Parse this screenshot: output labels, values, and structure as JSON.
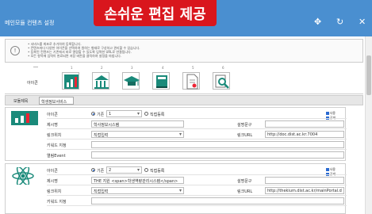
{
  "window": {
    "title": "메인모듈 컨텐츠 설정",
    "banner": "손쉬운 편집 제공",
    "controls": [
      "✥",
      "↻",
      "✕"
    ]
  },
  "info": {
    "icon": "!",
    "lines": [
      "• 서비스를 최초로 추가하여 등록합니다.",
      "• 컨텐츠마다 다양한 아이콘을 선택하여 원하는 형태로 구성하고 관리할 수 있습니다.",
      "• 등록된 컨텐츠는 기존에서 바로 열람할 수 있도록 입력한 URL로 연결됩니다.",
      "• 모든 항목에 입력이 완료되면 저장 버튼을 클릭하여 설정을 마칩니다."
    ]
  },
  "icon_picker": {
    "label": "아이콘",
    "numbers": [
      "***",
      "1",
      "2",
      "3",
      "4",
      "5",
      "6"
    ],
    "icons": [
      "bar-chart-icon",
      "building-icon",
      "graduation-cap-icon",
      "book-icon",
      "document-icon",
      "magnifier-icon"
    ]
  },
  "tag": {
    "label": "모듈제목",
    "value": "학생정보서비스"
  },
  "items": [
    {
      "icon_label": "아이콘",
      "radio_a": "기존",
      "radio_value": "1",
      "radio_b": "직접등록",
      "name_label": "제시명",
      "name_value": "학사정보시스템",
      "desc_label": "설명문구",
      "link_label": "링크위치",
      "link_value": "직접입력",
      "url_label": "링크URL",
      "url_value": "http://doc.dist.ac.kr:7004",
      "keyword_label": "키워드 지정",
      "extra_label": "열림Event",
      "checks": [
        "사용",
        "공개"
      ]
    },
    {
      "icon_label": "아이콘",
      "radio_a": "기존",
      "radio_value": "2",
      "radio_b": "직접등록",
      "name_label": "제시명",
      "name_value": "THE 지원 <span>학생역량관리시스템</span>",
      "desc_label": "설명문구",
      "link_label": "링크위치",
      "link_value": "직접입력",
      "url_label": "링크URL",
      "url_value": "http://thekium.dist.ac.kr/mainPortal.d",
      "keyword_label": "키워드 지정",
      "checks": [
        "사용",
        "공개"
      ]
    }
  ]
}
